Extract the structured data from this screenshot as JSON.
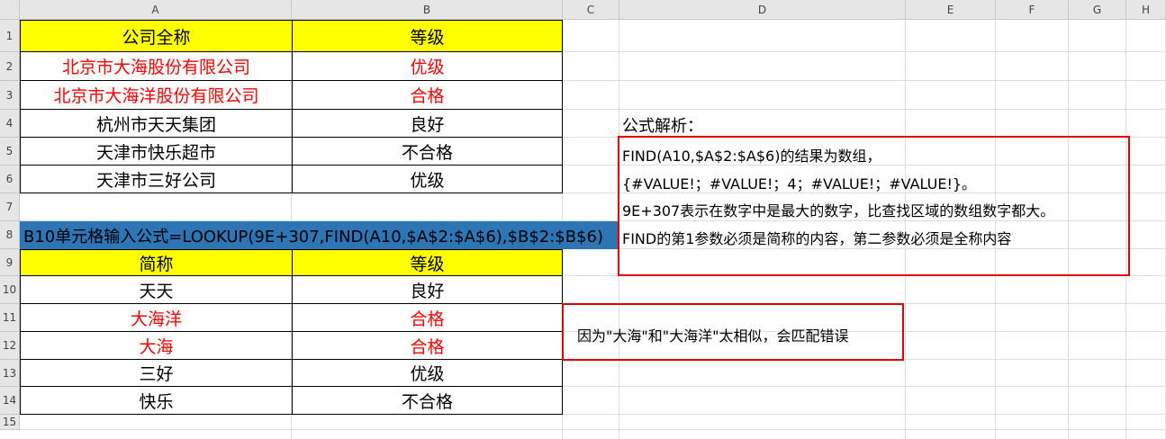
{
  "columns": [
    "A",
    "B",
    "C",
    "D",
    "E",
    "F",
    "G",
    "H"
  ],
  "rows": [
    "1",
    "2",
    "3",
    "4",
    "5",
    "6",
    "7",
    "8",
    "9",
    "10",
    "11",
    "12",
    "13",
    "14",
    "15"
  ],
  "table1": {
    "header": [
      "公司全称",
      "等级"
    ],
    "rows": [
      {
        "name": "北京市大海股份有限公司",
        "grade": "优级",
        "red": true
      },
      {
        "name": "北京市大海洋股份有限公司",
        "grade": "合格",
        "red": true
      },
      {
        "name": "杭州市天天集团",
        "grade": "良好",
        "red": false
      },
      {
        "name": "天津市快乐超市",
        "grade": "不合格",
        "red": false
      },
      {
        "name": "天津市三好公司",
        "grade": "优级",
        "red": false
      }
    ]
  },
  "formula_banner": "B10单元格输入公式=LOOKUP(9E+307,FIND(A10,$A$2:$A$6),$B$2:$B$6)",
  "table2": {
    "header": [
      "简称",
      "等级"
    ],
    "rows": [
      {
        "name": "天天",
        "grade": "良好",
        "red": false
      },
      {
        "name": "大海洋",
        "grade": "合格",
        "red": true
      },
      {
        "name": "大海",
        "grade": "合格",
        "red": true
      },
      {
        "name": "三好",
        "grade": "优级",
        "red": false
      },
      {
        "name": "快乐",
        "grade": "不合格",
        "red": false
      }
    ]
  },
  "analysis": {
    "title": "公式解析：",
    "lines": [
      "FIND(A10,$A$2:$A$6)的结果为数组，",
      "{#VALUE!；#VALUE!；4；#VALUE!；#VALUE!}。",
      "9E+307表示在数字中是最大的数字，比查找区域的数组数字都大。",
      "FIND的第1参数必须是简称的内容，第二参数必须是全称内容"
    ]
  },
  "note": "因为\"大海\"和\"大海洋\"太相似，会匹配错误",
  "colors": {
    "header_fill": "#ffff00",
    "banner_fill": "#2e75b6",
    "highlight_text": "#ff0000",
    "box_border": "#e00000"
  }
}
